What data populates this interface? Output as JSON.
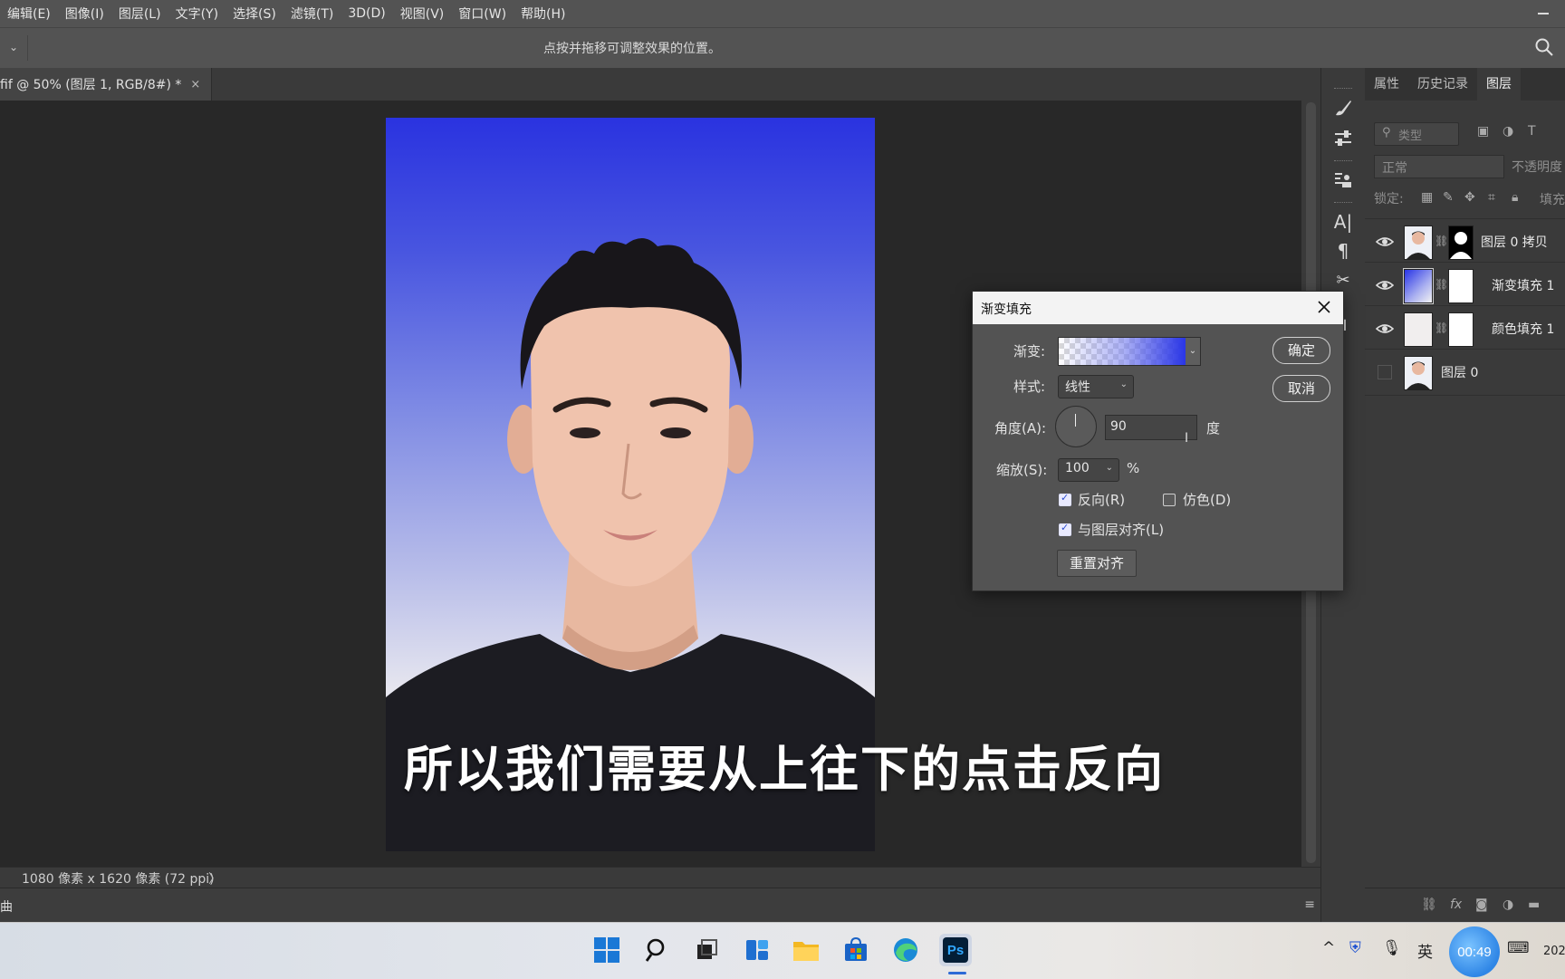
{
  "menu": [
    "编辑(E)",
    "图像(I)",
    "图层(L)",
    "文字(Y)",
    "选择(S)",
    "滤镜(T)",
    "3D(D)",
    "视图(V)",
    "窗口(W)",
    "帮助(H)"
  ],
  "options_bar": {
    "hint": "点按并拖移可调整效果的位置。"
  },
  "document": {
    "tab_title": "fif @ 50% (图层 1, RGB/8#) *",
    "close": "×"
  },
  "status": {
    "dimensions": "1080 像素 x 1620 像素 (72 ppi)",
    "arrow": "〉"
  },
  "timeline": {
    "label": "曲"
  },
  "subtitle": "所以我们需要从上往下的点击反向",
  "panel": {
    "tabs": [
      "属性",
      "历史记录",
      "图层"
    ],
    "active_tab": "图层",
    "filter_placeholder": "类型",
    "blend_mode": "正常",
    "opacity_label": "不透明度",
    "lock_label": "锁定:",
    "fill_label": "填充",
    "layers": [
      {
        "name": "图层 0 拷贝",
        "visible": true
      },
      {
        "name": "渐变填充 1",
        "visible": true
      },
      {
        "name": "颜色填充 1",
        "visible": true
      },
      {
        "name": "图层 0",
        "visible": false
      }
    ]
  },
  "dialog": {
    "title": "渐变填充",
    "gradient_label": "渐变:",
    "style_label": "样式:",
    "style_value": "线性",
    "angle_label": "角度(A):",
    "angle_value": "90",
    "angle_unit": "度",
    "scale_label": "缩放(S):",
    "scale_value": "100",
    "scale_unit": "%",
    "reverse_label": "反向(R)",
    "reverse_checked": true,
    "dither_label": "仿色(D)",
    "dither_checked": false,
    "align_label": "与图层对齐(L)",
    "align_checked": true,
    "reset_button": "重置对齐",
    "ok_button": "确定",
    "cancel_button": "取消",
    "gradient_colors": [
      "#ffffff",
      "#2834e6"
    ]
  },
  "taskbar": {
    "clock": "00:49",
    "ime": "英",
    "year_fragment": "202"
  },
  "colors": {
    "accent": "#31a8ff",
    "gradient_top": "#2a33e0"
  }
}
